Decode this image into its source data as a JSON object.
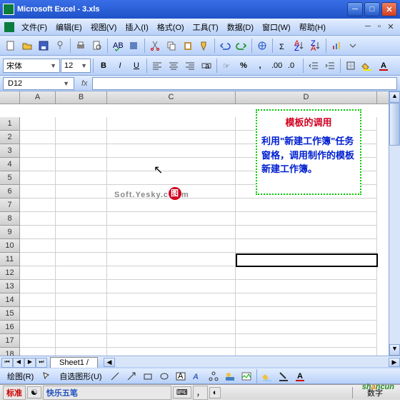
{
  "window": {
    "title": "Microsoft Excel - 3.xls"
  },
  "menu": {
    "file": "文件(F)",
    "edit": "编辑(E)",
    "view": "视图(V)",
    "insert": "插入(I)",
    "format": "格式(O)",
    "tools": "工具(T)",
    "data": "数据(D)",
    "window": "窗口(W)",
    "help": "帮助(H)"
  },
  "font": {
    "name": "宋体",
    "size": "12"
  },
  "namebox": {
    "ref": "D12"
  },
  "columns": [
    "A",
    "B",
    "C",
    "D"
  ],
  "rows": [
    1,
    2,
    3,
    4,
    5,
    6,
    7,
    8,
    9,
    10,
    11,
    12,
    13,
    14,
    15,
    16,
    17,
    18
  ],
  "selected": {
    "row": 12,
    "col": "D"
  },
  "tab": {
    "name": "Sheet1"
  },
  "callout": {
    "title": "模板的调用",
    "body": "利用\"新建工作簿\"任务窗格，调用制作的模板新建工作簿。"
  },
  "watermark": {
    "text": "Soft.Yesky.c",
    "suffix": "m",
    "badge": "图"
  },
  "drawbar": {
    "label": "绘图(R)",
    "autoshape": "自选图形(U)"
  },
  "ime": {
    "label": "快乐五笔"
  },
  "status": {
    "numlock": "数字"
  },
  "logo": {
    "p1": "sh",
    "p2": "a",
    "p3": "ncun"
  }
}
